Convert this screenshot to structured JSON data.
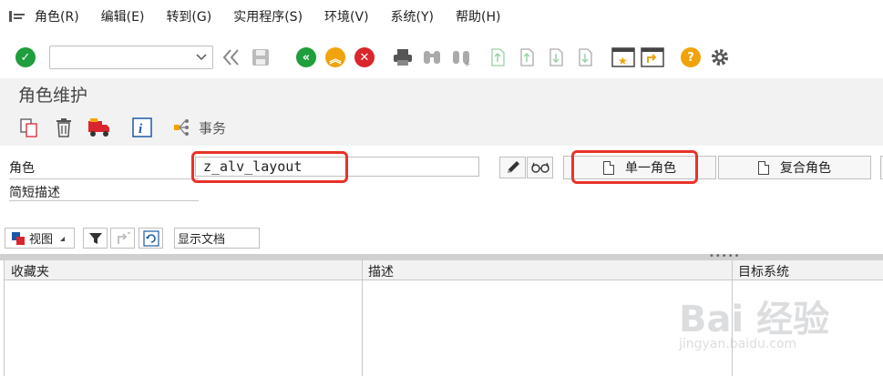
{
  "menubar": {
    "items": [
      "角色(R)",
      "编辑(E)",
      "转到(G)",
      "实用程序(S)",
      "环境(V)",
      "系统(Y)",
      "帮助(H)"
    ]
  },
  "toolbar": {
    "command_field": "",
    "icons": [
      "check-icon",
      "back-double-icon",
      "save-icon",
      "back-icon",
      "exit-icon",
      "cancel-icon",
      "print-icon",
      "find-icon",
      "find-next-icon",
      "first-page-icon",
      "prev-page-icon",
      "next-page-icon",
      "last-page-icon",
      "new-session-icon",
      "shortcut-icon",
      "help-icon",
      "settings-icon"
    ]
  },
  "title": "角色维护",
  "app_toolbar": {
    "transaction_label": "事务"
  },
  "form": {
    "role_label": "角色",
    "role_value": "z_alv_layout",
    "short_desc_label": "简短描述",
    "single_role_button": "单一角色",
    "composite_role_button": "复合角色"
  },
  "tree_toolbar": {
    "view_label": "视图",
    "show_doc_label": "显示文档"
  },
  "table": {
    "headers": [
      "收藏夹",
      "描述",
      "目标系统"
    ]
  },
  "watermark": {
    "main": "Bai 经验",
    "sub": "jingyan.baidu.com"
  },
  "colors": {
    "highlight": "#e8332a",
    "green": "#1e9e3c",
    "orange": "#f0a30a",
    "red": "#d9262c"
  }
}
